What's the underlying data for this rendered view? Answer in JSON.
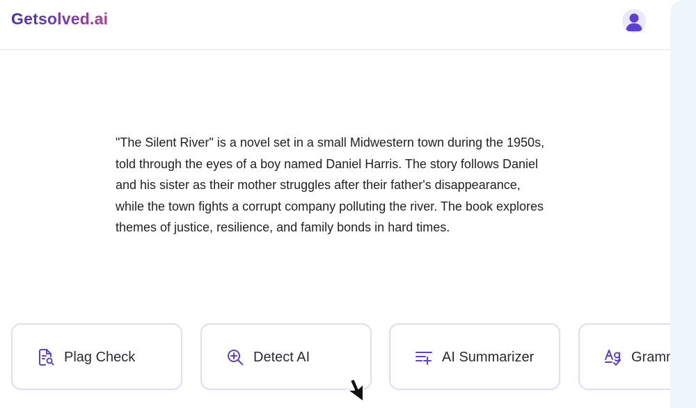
{
  "header": {
    "logo_text": "Getsolved.ai",
    "avatar_icon": "user-avatar-icon"
  },
  "content": {
    "summary_text": "\"The Silent River\" is a novel set in a small Midwestern town during the 1950s, told through the eyes of a boy named Daniel Harris. The story follows Daniel and his sister as their mother struggles after their father's disappearance, while the town fights a corrupt company polluting the river. The book explores themes of justice, resilience, and family bonds in hard times."
  },
  "tools": [
    {
      "label": "Plag Check",
      "icon": "plag-check-icon"
    },
    {
      "label": "Detect AI",
      "icon": "detect-ai-icon"
    },
    {
      "label": "AI Summarizer",
      "icon": "summarizer-icon"
    },
    {
      "label": "Gramm",
      "icon": "grammar-icon"
    }
  ],
  "colors": {
    "accent": "#5b3fd6",
    "logo_gradient_start": "#4b2fb0",
    "logo_gradient_end": "#b23c8c",
    "card_border": "#e1ddf6",
    "side_panel": "#eef6fb"
  }
}
